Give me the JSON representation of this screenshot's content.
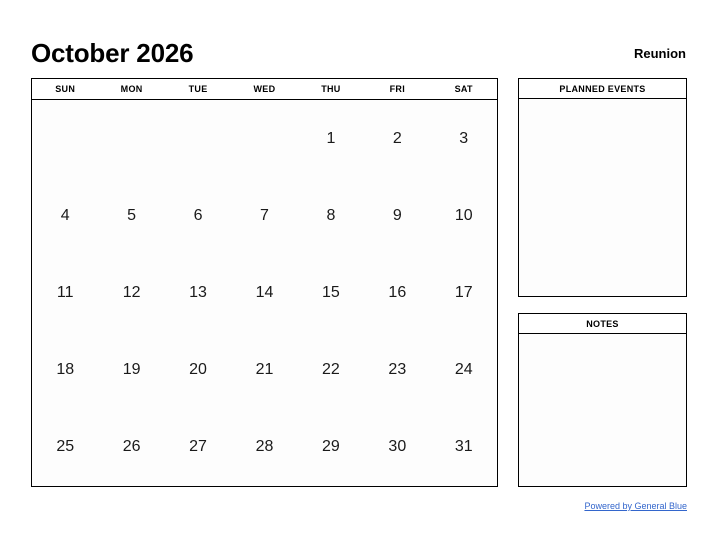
{
  "header": {
    "month_title": "October 2026",
    "location": "Reunion"
  },
  "calendar": {
    "weekdays": [
      "SUN",
      "MON",
      "TUE",
      "WED",
      "THU",
      "FRI",
      "SAT"
    ],
    "weeks": [
      [
        "",
        "",
        "",
        "",
        "1",
        "2",
        "3"
      ],
      [
        "4",
        "5",
        "6",
        "7",
        "8",
        "9",
        "10"
      ],
      [
        "11",
        "12",
        "13",
        "14",
        "15",
        "16",
        "17"
      ],
      [
        "18",
        "19",
        "20",
        "21",
        "22",
        "23",
        "24"
      ],
      [
        "25",
        "26",
        "27",
        "28",
        "29",
        "30",
        "31"
      ]
    ]
  },
  "panels": {
    "planned_events": {
      "title": "PLANNED EVENTS",
      "content": ""
    },
    "notes": {
      "title": "NOTES",
      "content": ""
    }
  },
  "footer": {
    "link_text": "Powered by General Blue"
  },
  "colors": {
    "text": "#000000",
    "border": "#000000",
    "link": "#3366cc",
    "page_background": "#ffffff",
    "cell_background": "#fdfdfd"
  }
}
